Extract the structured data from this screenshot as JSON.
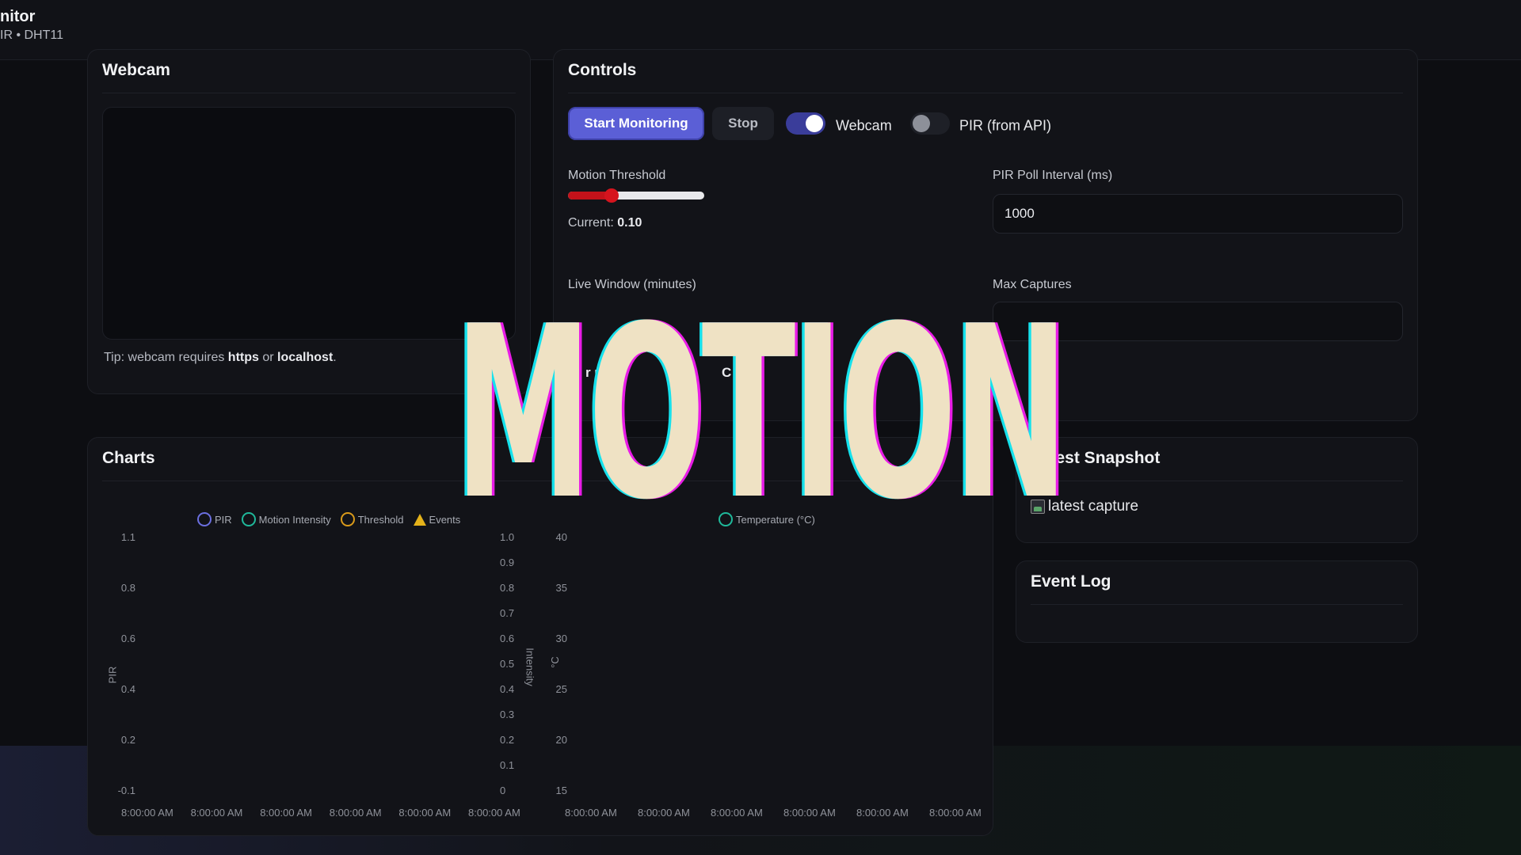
{
  "header": {
    "title": "nitor",
    "subtitle": "IR • DHT11"
  },
  "webcam": {
    "title": "Webcam",
    "tip_prefix": "Tip: webcam requires ",
    "tip_https": "https",
    "tip_or": " or ",
    "tip_localhost": "localhost",
    "tip_end": "."
  },
  "controls": {
    "title": "Controls",
    "start_label": "Start Monitoring",
    "stop_label": "Stop",
    "webcam_toggle_label": "Webcam",
    "webcam_toggle_on": true,
    "pir_toggle_label": "PIR (from API)",
    "pir_toggle_on": false,
    "motion_threshold_label": "Motion Threshold",
    "motion_threshold_value": 0.1,
    "current_prefix": "Current: ",
    "current_value": "0.10",
    "pir_poll_label": "PIR Poll Interval (ms)",
    "pir_poll_value": "1000",
    "live_window_label": "Live Window (minutes)",
    "max_captures_label": "Max Captures",
    "btn_partial_1": "r     u",
    "btn_partial_2": "C     har"
  },
  "charts": {
    "title": "Charts",
    "legend": [
      {
        "label": "PIR",
        "color": "#6b6fe0",
        "shape": "circle"
      },
      {
        "label": "Motion Intensity",
        "color": "#1fb89a",
        "shape": "circle"
      },
      {
        "label": "Threshold",
        "color": "#d99a1a",
        "shape": "circle"
      },
      {
        "label": "Events",
        "color": "#e4b21a",
        "shape": "triangle"
      }
    ],
    "legend2": [
      {
        "label": "Temperature (°C)",
        "color": "#1fb89a",
        "shape": "circle"
      }
    ]
  },
  "chart_data": [
    {
      "type": "line",
      "ylabel": "PIR",
      "y2label": "Intensity",
      "yticks": [
        "1.1",
        "0.8",
        "0.6",
        "0.4",
        "0.2",
        "-0.1"
      ],
      "y2ticks": [
        "1.0",
        "0.9",
        "0.8",
        "0.7",
        "0.6",
        "0.5",
        "0.4",
        "0.3",
        "0.2",
        "0.1",
        "0"
      ],
      "xticks": [
        "8:00:00 AM",
        "8:00:00 AM",
        "8:00:00 AM",
        "8:00:00 AM",
        "8:00:00 AM",
        "8:00:00 AM"
      ],
      "series": [
        {
          "name": "PIR",
          "values": []
        },
        {
          "name": "Motion Intensity",
          "values": []
        },
        {
          "name": "Threshold",
          "values": []
        },
        {
          "name": "Events",
          "values": []
        }
      ]
    },
    {
      "type": "line",
      "ylabel": "°C",
      "yticks": [
        "40",
        "35",
        "30",
        "25",
        "20",
        "15"
      ],
      "xticks": [
        "8:00:00 AM",
        "8:00:00 AM",
        "8:00:00 AM",
        "8:00:00 AM",
        "8:00:00 AM",
        "8:00:00 AM"
      ],
      "series": [
        {
          "name": "Temperature (°C)",
          "values": []
        }
      ]
    }
  ],
  "snapshot": {
    "title": "Latest Snapshot",
    "alt_text": "latest capture"
  },
  "event_log": {
    "title": "Event Log"
  },
  "overlay": {
    "text": "MOTION"
  }
}
